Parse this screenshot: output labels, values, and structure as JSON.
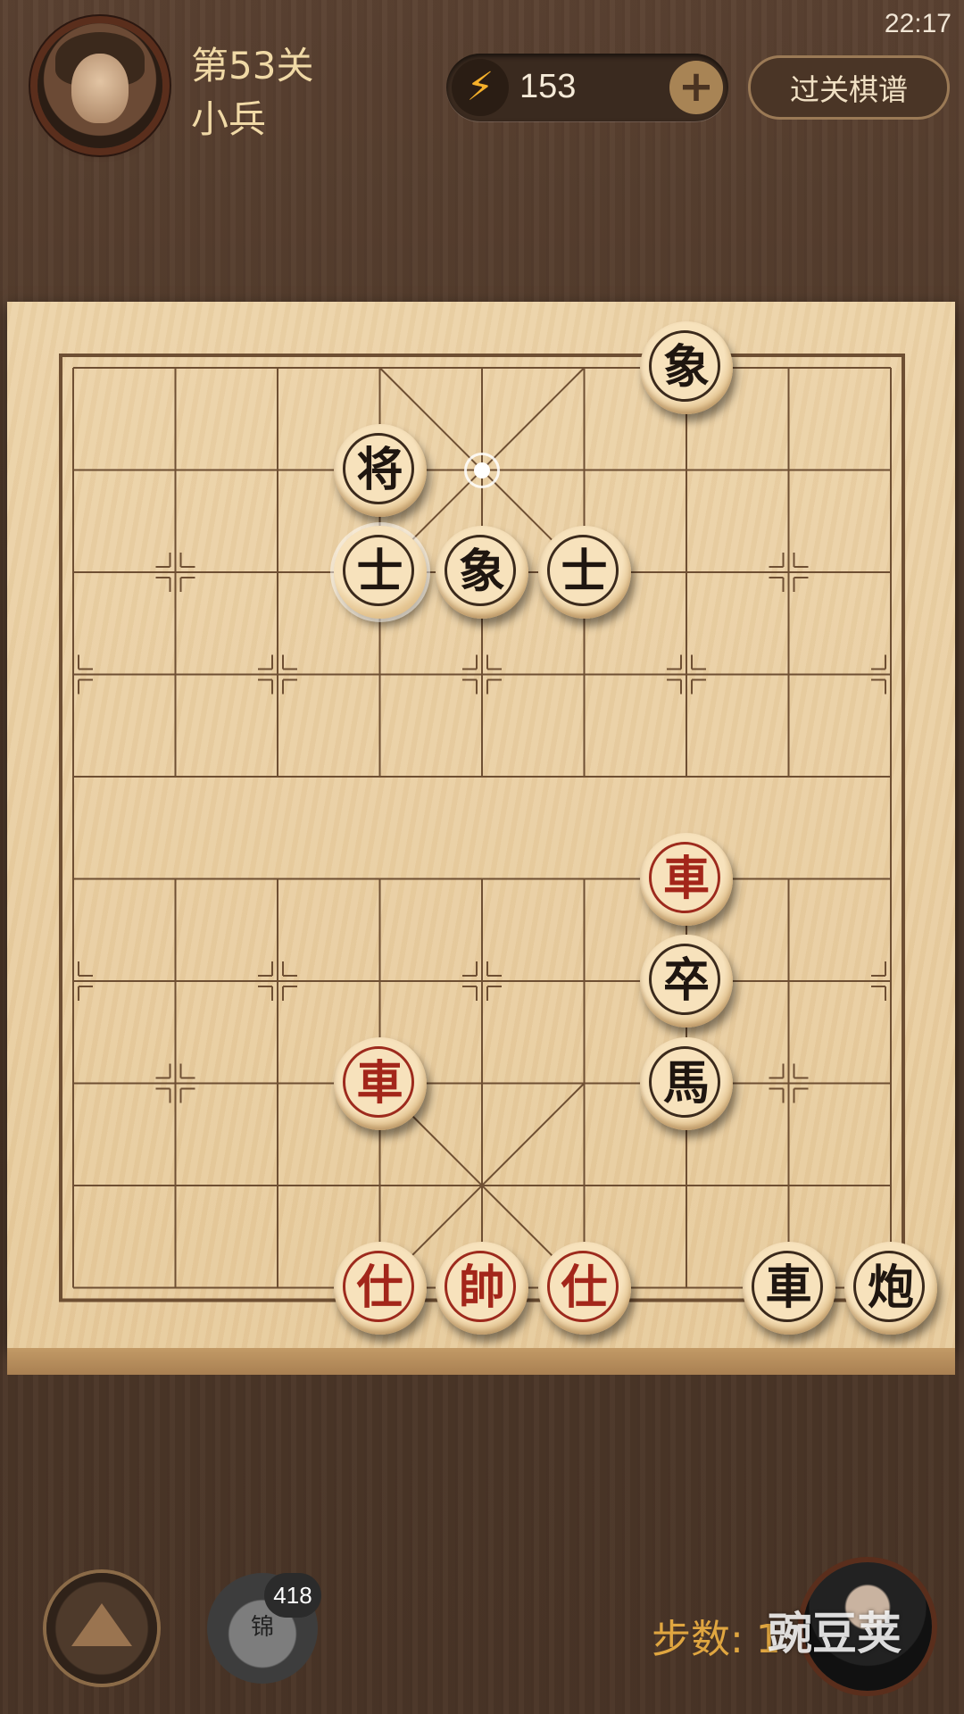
{
  "status": {
    "time": "22:17"
  },
  "header": {
    "level_title": "第53关",
    "opponent_name": "小兵",
    "energy_value": "153",
    "replay_button": "过关棋谱"
  },
  "board": {
    "cols": 9,
    "rows": 10,
    "pieces": [
      {
        "label": "象",
        "side": "black",
        "col": 6,
        "row": 0
      },
      {
        "label": "将",
        "side": "black",
        "col": 3,
        "row": 1
      },
      {
        "label": "士",
        "side": "black",
        "col": 3,
        "row": 2,
        "selected": true
      },
      {
        "label": "象",
        "side": "black",
        "col": 4,
        "row": 2
      },
      {
        "label": "士",
        "side": "black",
        "col": 5,
        "row": 2
      },
      {
        "label": "車",
        "side": "red",
        "col": 6,
        "row": 5
      },
      {
        "label": "卒",
        "side": "black",
        "col": 6,
        "row": 6
      },
      {
        "label": "車",
        "side": "red",
        "col": 3,
        "row": 7
      },
      {
        "label": "馬",
        "side": "black",
        "col": 6,
        "row": 7
      },
      {
        "label": "仕",
        "side": "red",
        "col": 3,
        "row": 9
      },
      {
        "label": "帥",
        "side": "red",
        "col": 4,
        "row": 9
      },
      {
        "label": "仕",
        "side": "red",
        "col": 5,
        "row": 9
      },
      {
        "label": "車",
        "side": "black",
        "col": 7,
        "row": 9
      },
      {
        "label": "炮",
        "side": "black",
        "col": 8,
        "row": 9
      }
    ],
    "hint_point": {
      "col": 4,
      "row": 1
    }
  },
  "footer": {
    "bag_label": "锦",
    "bag_count": "418",
    "steps_text": "步数: 1",
    "watermark": "豌豆荚"
  }
}
